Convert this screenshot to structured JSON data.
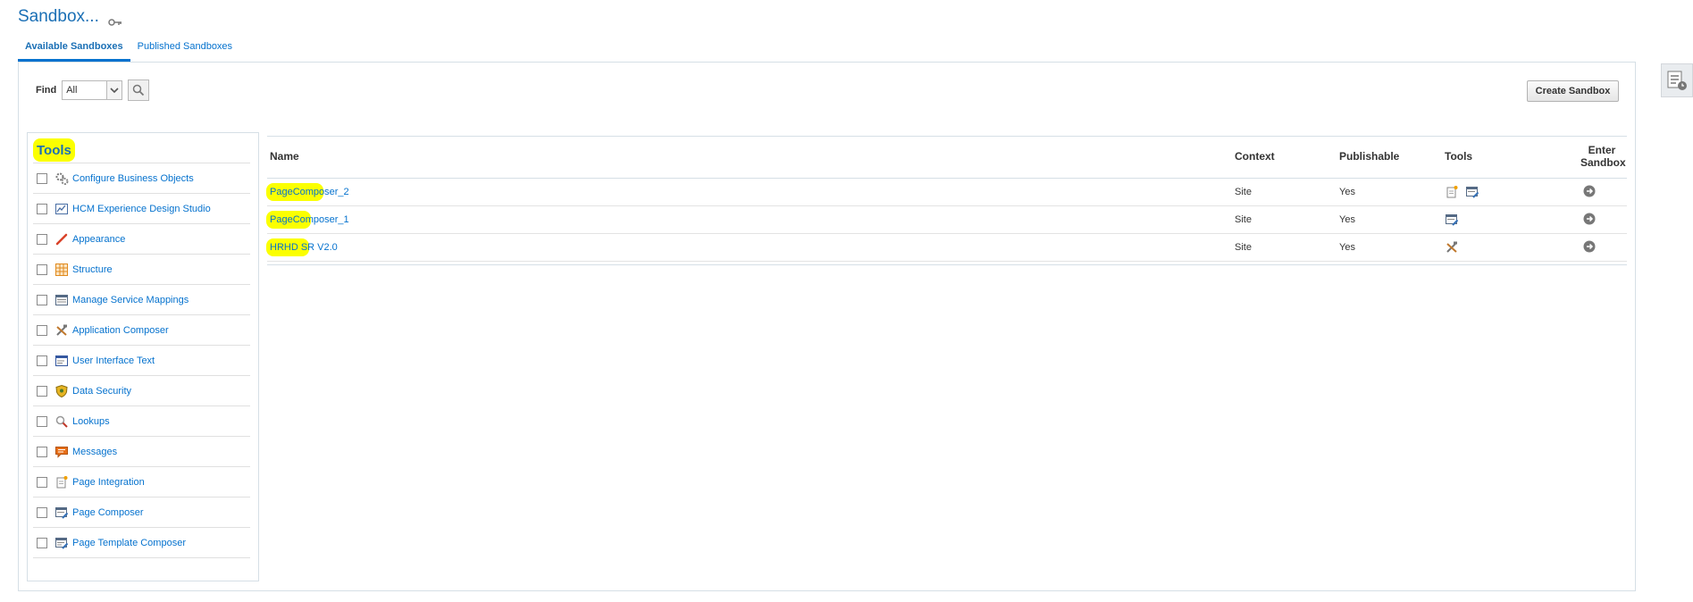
{
  "page": {
    "title": "Sandbox...",
    "title_icon": "key-icon"
  },
  "tabs": [
    {
      "label": "Available Sandboxes",
      "active": true
    },
    {
      "label": "Published Sandboxes",
      "active": false
    }
  ],
  "find": {
    "label": "Find",
    "selected": "All"
  },
  "actions": {
    "create_label": "Create Sandbox"
  },
  "tools": {
    "title": "Tools",
    "items": [
      {
        "label": "Configure Business Objects",
        "icon": "gears-icon"
      },
      {
        "label": "HCM Experience Design Studio",
        "icon": "design-studio-icon"
      },
      {
        "label": "Appearance",
        "icon": "brush-icon"
      },
      {
        "label": "Structure",
        "icon": "grid-icon"
      },
      {
        "label": "Manage Service Mappings",
        "icon": "mapping-list-icon"
      },
      {
        "label": "Application Composer",
        "icon": "tools-icon"
      },
      {
        "label": "User Interface Text",
        "icon": "text-window-icon"
      },
      {
        "label": "Data Security",
        "icon": "shield-icon"
      },
      {
        "label": "Lookups",
        "icon": "magnifier-icon"
      },
      {
        "label": "Messages",
        "icon": "speech-bubble-icon"
      },
      {
        "label": "Page Integration",
        "icon": "page-integration-icon"
      },
      {
        "label": "Page Composer",
        "icon": "page-composer-icon"
      },
      {
        "label": "Page Template Composer",
        "icon": "page-template-icon"
      }
    ]
  },
  "table": {
    "columns": {
      "name": "Name",
      "context": "Context",
      "publishable": "Publishable",
      "tools": "Tools",
      "enter_line1": "Enter",
      "enter_line2": "Sandbox"
    },
    "rows": [
      {
        "name": "PageComposer_2",
        "context": "Site",
        "publishable": "Yes",
        "tool_icons": [
          "page-integration-icon",
          "page-composer-icon"
        ]
      },
      {
        "name": "PageComposer_1",
        "context": "Site",
        "publishable": "Yes",
        "tool_icons": [
          "page-composer-icon"
        ]
      },
      {
        "name": "HRHD SR V2.0",
        "context": "Site",
        "publishable": "Yes",
        "tool_icons": [
          "tools-icon"
        ]
      }
    ]
  },
  "colors": {
    "link": "#0572ce",
    "highlight": "#fbff00",
    "title": "#1a6fb5"
  }
}
